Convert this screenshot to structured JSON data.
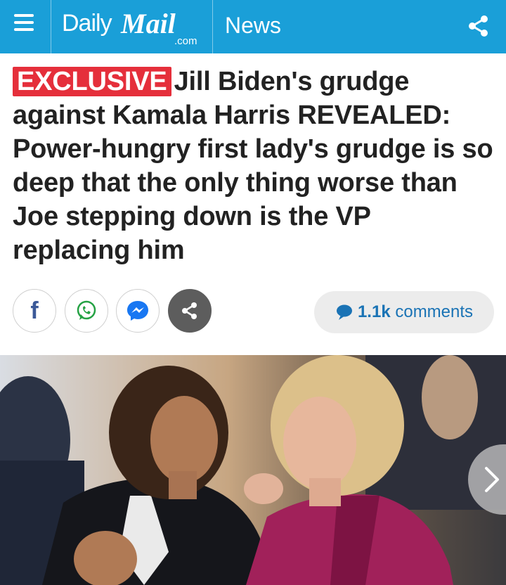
{
  "header": {
    "brand_daily": "Daily",
    "brand_mail": "Mail",
    "brand_com": ".com",
    "section": "News",
    "bg_color": "#1a9fd8"
  },
  "article": {
    "badge": "EXCLUSIVE",
    "headline": "Jill Biden's grudge against Kamala Harris REVEALED: Power-hungry first lady's grudge is so deep that the only thing worse than Joe stepping down is the VP replacing him",
    "badge_color": "#e52f3b"
  },
  "share": {
    "buttons": [
      "facebook-icon",
      "whatsapp-icon",
      "messenger-icon",
      "share-icon"
    ],
    "comments_count": "1.1k",
    "comments_label": "comments"
  },
  "icons": {
    "menu": "hamburger-icon",
    "share_top": "share-icon",
    "comment": "speech-bubble-icon",
    "next": "chevron-right-icon"
  }
}
